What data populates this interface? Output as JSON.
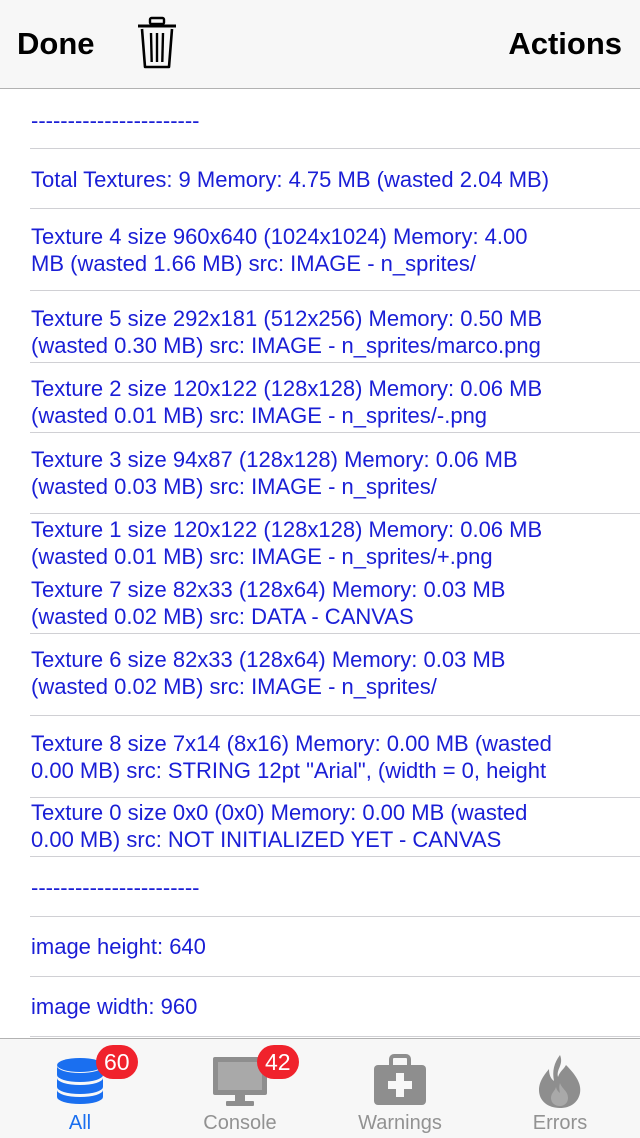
{
  "navbar": {
    "done_label": "Done",
    "actions_label": "Actions",
    "trash_icon": "trash-icon"
  },
  "log": {
    "rows": [
      {
        "text": "-----------------------"
      },
      {
        "text": "Total Textures: 9 Memory: 4.75 MB (wasted 2.04 MB)"
      },
      {
        "text": "Texture 4 size 960x640 (1024x1024) Memory: 4.00\nMB (wasted 1.66 MB) src: IMAGE - n_sprites/"
      },
      {
        "text": "Texture 5 size 292x181 (512x256) Memory: 0.50 MB\n(wasted 0.30 MB) src: IMAGE - n_sprites/marco.png"
      },
      {
        "text": "Texture 2 size 120x122 (128x128) Memory: 0.06 MB\n(wasted 0.01 MB) src: IMAGE - n_sprites/-.png"
      },
      {
        "text": "Texture 3 size 94x87 (128x128) Memory: 0.06 MB\n(wasted 0.03 MB) src: IMAGE - n_sprites/"
      },
      {
        "text": "Texture 1 size 120x122 (128x128) Memory: 0.06 MB\n(wasted 0.01 MB) src: IMAGE - n_sprites/+.png"
      },
      {
        "text": "Texture 7 size 82x33 (128x64) Memory: 0.03 MB\n(wasted 0.02 MB) src: DATA - CANVAS"
      },
      {
        "text": "Texture 6 size 82x33 (128x64) Memory: 0.03 MB\n(wasted 0.02 MB) src: IMAGE - n_sprites/"
      },
      {
        "text": "Texture 8 size 7x14 (8x16) Memory: 0.00 MB (wasted\n0.00 MB) src: STRING 12pt \"Arial\", (width = 0, height"
      },
      {
        "text": "Texture 0 size 0x0 (0x0) Memory: 0.00 MB (wasted\n0.00 MB) src: NOT INITIALIZED YET - CANVAS"
      },
      {
        "text": "-----------------------"
      },
      {
        "text": "image height: 640"
      },
      {
        "text": "image width: 960"
      }
    ]
  },
  "tabbar": {
    "tabs": [
      {
        "label": "All",
        "badge": "60",
        "icon": "database-icon",
        "active": true
      },
      {
        "label": "Console",
        "badge": "42",
        "icon": "monitor-icon",
        "active": false
      },
      {
        "label": "Warnings",
        "icon": "first-aid-kit-icon",
        "active": false
      },
      {
        "label": "Errors",
        "icon": "fire-icon",
        "active": false
      }
    ]
  },
  "colors": {
    "link_text": "#1a1ed6",
    "active_tab": "#1a6ff0",
    "inactive_tab": "#929292",
    "badge": "#f0222c"
  }
}
